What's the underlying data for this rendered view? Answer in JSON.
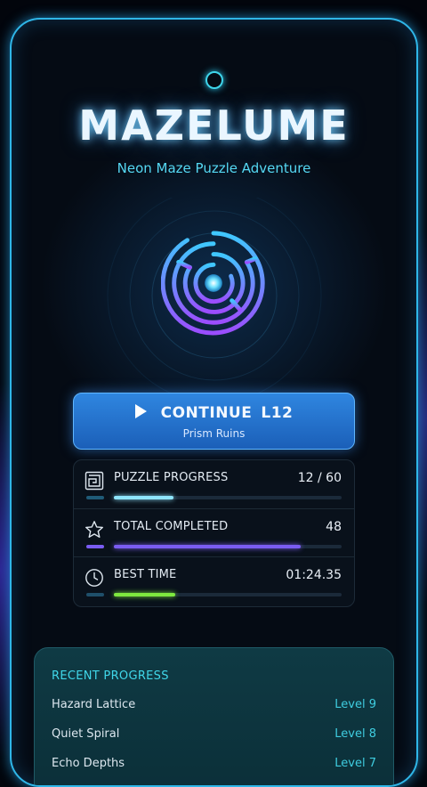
{
  "app": {
    "title": "MAZELUME",
    "subtitle": "Neon Maze Puzzle Adventure"
  },
  "continue_button": {
    "label": "CONTINUE",
    "level": "L12",
    "stage": "Prism Ruins"
  },
  "stats": [
    {
      "label": "PUZZLE PROGRESS",
      "value": "12 / 60",
      "progress": 0.26,
      "icon": "maze-icon",
      "color": "#8fe6ff",
      "stub_color": "#1f5b78"
    },
    {
      "label": "TOTAL COMPLETED",
      "value": "48",
      "progress": 0.82,
      "icon": "star-icon",
      "color": "#7a5cf2",
      "stub_color": "#7a5cf2"
    },
    {
      "label": "BEST TIME",
      "value": "01:24.35",
      "progress": 0.27,
      "icon": "clock-icon",
      "color": "#7ee83f",
      "stub_color": "#1f4f6a"
    }
  ],
  "recent_progress": {
    "heading": "RECENT PROGRESS",
    "items": [
      {
        "name": "Hazard Lattice",
        "level": "Level 9"
      },
      {
        "name": "Quiet Spiral",
        "level": "Level 8"
      },
      {
        "name": "Echo Depths",
        "level": "Level 7"
      }
    ]
  }
}
